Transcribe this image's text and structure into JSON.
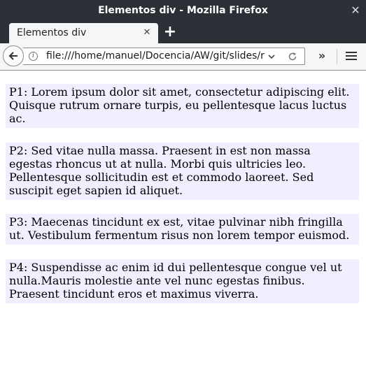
{
  "window": {
    "title": "Elementos div - Mozilla Firefox"
  },
  "tabs": [
    {
      "label": "Elementos div"
    }
  ],
  "toolbar": {
    "url": "file:///home/manuel/Docencia/AW/git/slides/resources/"
  },
  "page": {
    "background": "#efefff",
    "paragraphs": [
      "P1: Lorem ipsum dolor sit amet, consectetur adipiscing elit. Quisque rutrum ornare turpis, eu pellentesque lacus luctus ac.",
      "P2: Sed vitae nulla massa. Praesent in est non massa egestas rhoncus ut at nulla. Morbi quis ultricies leo. Pellentesque sollicitudin est et commodo laoreet. Sed suscipit eget sapien id aliquet.",
      "P3: Maecenas tincidunt ex est, vitae pulvinar nibh fringilla ut. Vestibulum fermentum risus non lorem tempor euismod.",
      "P4: Suspendisse ac enim id dui pellentesque congue vel ut nulla.Mauris molestie ante vel nunc egestas finibus. Praesent tincidunt eros et maximus viverra."
    ]
  },
  "icons": {
    "close_window": "close-icon",
    "close_tab": "close-icon",
    "new_tab": "plus-icon",
    "back": "back-arrow-icon",
    "info": "info-icon",
    "dropdown": "chevron-down-icon",
    "reload": "reload-icon",
    "overflow": "double-chevron-right-icon",
    "menu": "hamburger-menu-icon"
  }
}
